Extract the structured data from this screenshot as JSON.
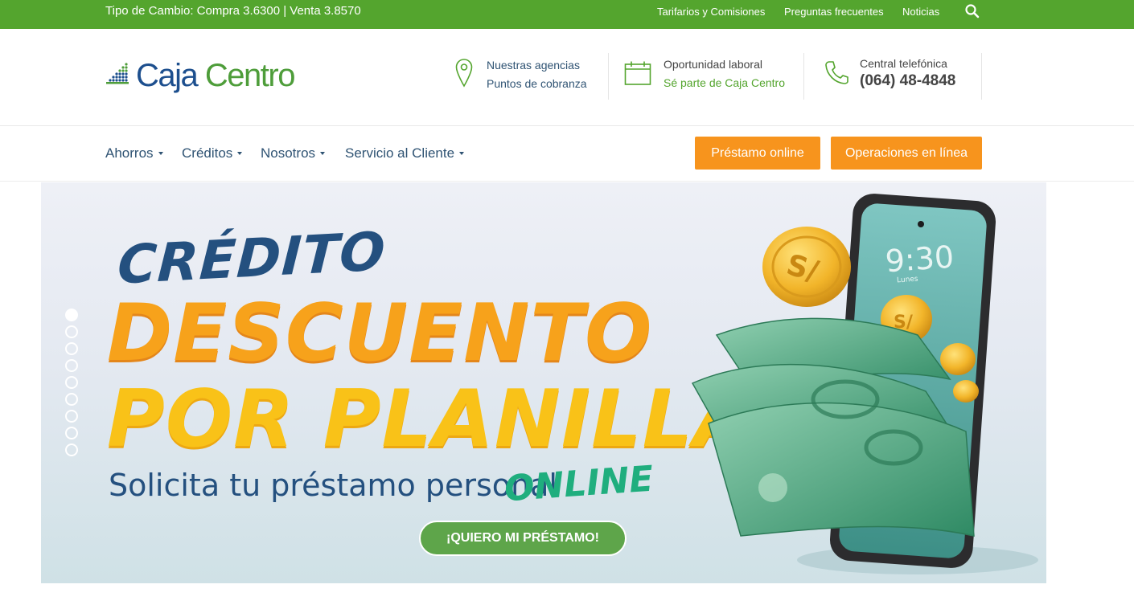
{
  "topbar": {
    "exchange_rate": "Tipo de Cambio: Compra 3.6300 | Venta 3.8570",
    "links": [
      "Tarifarios y Comisiones",
      "Preguntas frecuentes",
      "Noticias"
    ],
    "search_icon": "search-icon",
    "bg_color": "#54a52e"
  },
  "header": {
    "logo": {
      "part1": "Caja",
      "part2": "Centro"
    },
    "agencies": {
      "line1": "Nuestras agencias",
      "line2": "Puntos de cobranza",
      "icon": "map-pin-icon"
    },
    "jobs": {
      "line1": "Oportunidad laboral",
      "line2": "Sé parte de Caja Centro",
      "icon": "calendar-icon"
    },
    "phone": {
      "line1": "Central telefónica",
      "line2": "(064) 48-4848",
      "icon": "phone-icon"
    }
  },
  "nav": {
    "items": [
      "Ahorros",
      "Créditos",
      "Nosotros",
      "Servicio al Cliente"
    ],
    "buttons": [
      "Préstamo online",
      "Operaciones en línea"
    ],
    "button_color": "#f7941d"
  },
  "banner": {
    "line1": "CRÉDITO",
    "line2": "DESCUENTO",
    "line3": "POR PLANILLA",
    "subtitle": "Solicita tu préstamo personal",
    "online": "ONLINE",
    "cta": "¡QUIERO MI PRÉSTAMO!",
    "slides_total": 9,
    "active_slide": 1,
    "phone_time": "9:30",
    "phone_day": "Lunes",
    "coin_symbol": "S/"
  }
}
